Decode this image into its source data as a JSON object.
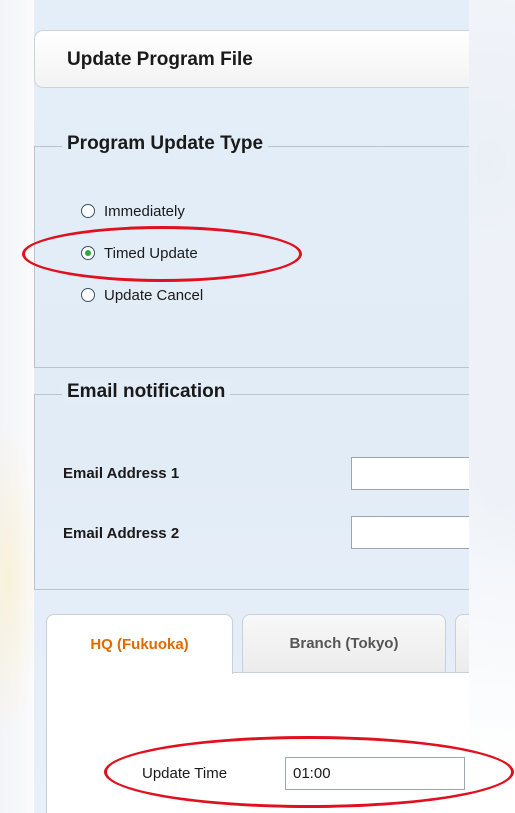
{
  "header": {
    "title": "Update Program File"
  },
  "update_type": {
    "legend": "Program Update Type",
    "options": [
      {
        "label": "Immediately",
        "checked": false
      },
      {
        "label": "Timed Update",
        "checked": true
      },
      {
        "label": "Update Cancel",
        "checked": false
      }
    ]
  },
  "email": {
    "legend": "Email notification",
    "fields": [
      {
        "label": "Email Address 1",
        "value": ""
      },
      {
        "label": "Email Address 2",
        "value": ""
      }
    ]
  },
  "tabs": [
    {
      "label": "HQ (Fukuoka)",
      "active": true
    },
    {
      "label": "Branch (Tokyo)",
      "active": false
    }
  ],
  "schedule": {
    "update_time_label": "Update Time",
    "update_time_value": "01:00"
  },
  "colors": {
    "active_tab": "#e06a00",
    "highlight": "#e0101e",
    "radio_checked": "#2fa83a"
  }
}
